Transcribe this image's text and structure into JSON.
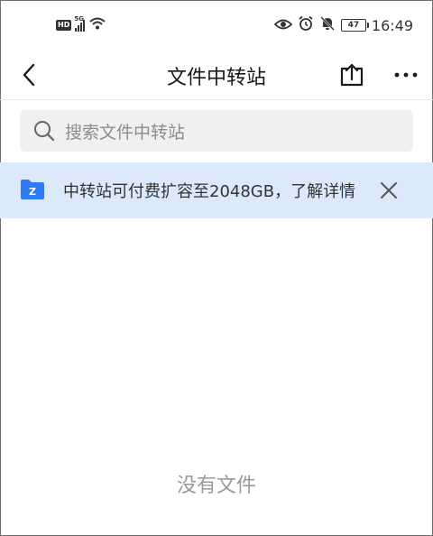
{
  "status_bar": {
    "hd": "HD",
    "network": "5G",
    "battery": "47",
    "time": "16:49"
  },
  "nav": {
    "title": "文件中转站"
  },
  "search": {
    "placeholder": "搜索文件中转站"
  },
  "banner": {
    "message": "中转站可付费扩容至2048GB，了解详情",
    "folder_badge": "Z"
  },
  "empty_state": {
    "text": "没有文件"
  },
  "colors": {
    "banner_bg": "#dbe9fb",
    "folder_icon": "#2f7cf6",
    "search_bg": "#f0f0f2"
  }
}
